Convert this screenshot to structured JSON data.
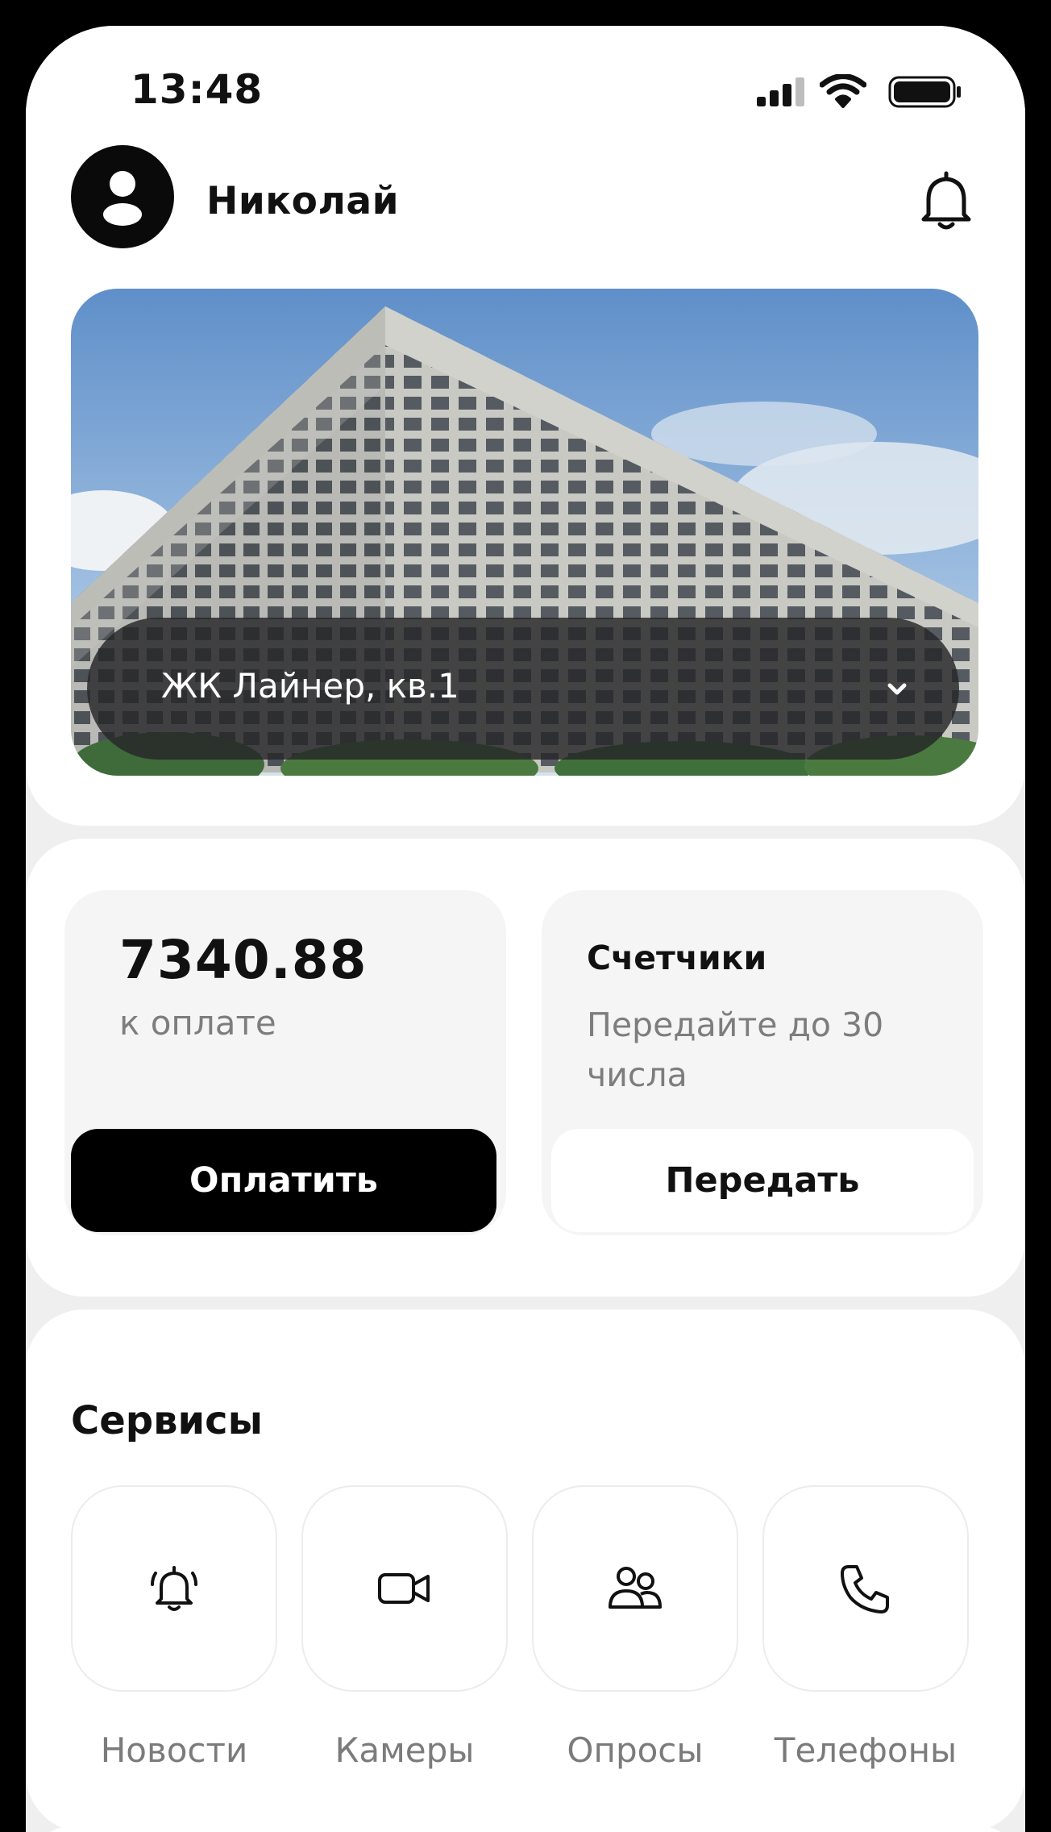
{
  "status_bar": {
    "time": "13:48"
  },
  "header": {
    "user_name": "Николай"
  },
  "property": {
    "address": "ЖК Лайнер, кв.1"
  },
  "payment": {
    "amount": "7340.88",
    "caption": "к оплате",
    "button_label": "Оплатить"
  },
  "meters": {
    "title": "Счетчики",
    "subtitle": "Передайте до 30 числа",
    "button_label": "Передать"
  },
  "services": {
    "title": "Сервисы",
    "items": [
      {
        "label": "Новости",
        "icon": "alarm-bell-icon"
      },
      {
        "label": "Камеры",
        "icon": "video-camera-icon"
      },
      {
        "label": "Опросы",
        "icon": "people-icon"
      },
      {
        "label": "Телефоны",
        "icon": "phone-icon"
      }
    ]
  },
  "colors": {
    "primary": "#000000",
    "background": "#efefef",
    "card": "#ffffff",
    "tile": "#f5f5f5",
    "muted_text": "#7d7d7d"
  }
}
